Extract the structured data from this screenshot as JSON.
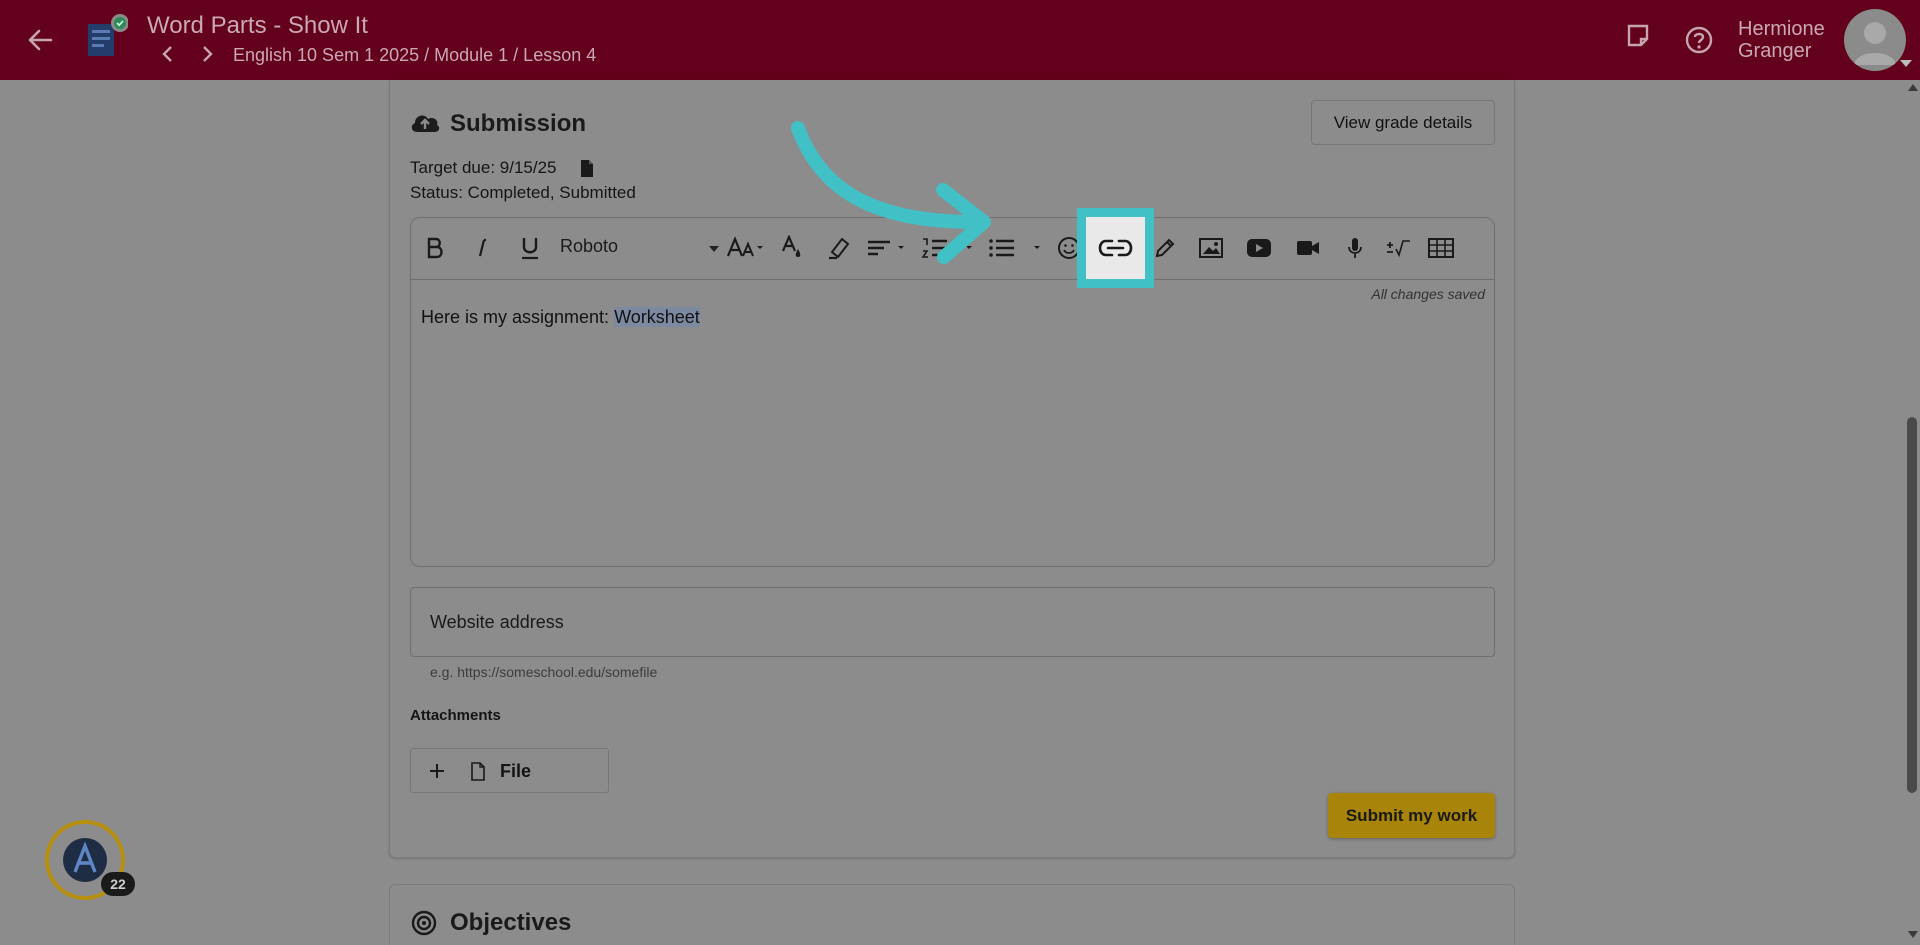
{
  "header": {
    "title": "Word Parts - Show It",
    "breadcrumb": "English 10 Sem 1 2025 / Module 1 / Lesson 4",
    "user_name_line1": "Hermione",
    "user_name_line2": "Granger"
  },
  "submission": {
    "title": "Submission",
    "view_grade_label": "View grade details",
    "target_due": "Target due: 9/15/25",
    "status": "Status: Completed, Submitted"
  },
  "editor": {
    "font_name": "Roboto",
    "saved_text": "All changes saved",
    "content_prefix": "Here is my assignment: ",
    "content_selected": "Worksheet",
    "toolbar_icons": [
      "bold-icon",
      "italic-icon",
      "underline-icon",
      "font-size-icon",
      "text-color-icon",
      "highlight-icon",
      "align-icon",
      "numbered-list-icon",
      "bullet-list-icon",
      "emoji-icon",
      "link-icon",
      "pen-icon",
      "image-icon",
      "youtube-icon",
      "video-icon",
      "mic-icon",
      "math-icon",
      "table-icon"
    ]
  },
  "website": {
    "placeholder": "Website address",
    "hint": "e.g. https://someschool.edu/somefile"
  },
  "attachments": {
    "label": "Attachments",
    "file_label": "File"
  },
  "submit_label": "Submit my work",
  "objectives": {
    "title": "Objectives"
  },
  "badge": {
    "count": "22"
  },
  "colors": {
    "header_bg": "#63001b",
    "highlight": "#41c0c6",
    "submit_bg": "#a88409",
    "badge_ring": "#b8900f"
  }
}
